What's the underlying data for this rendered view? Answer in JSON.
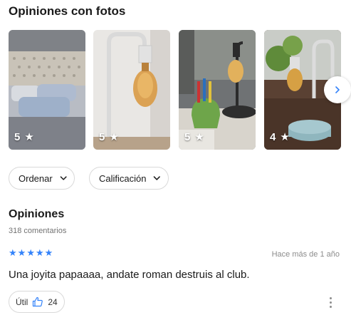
{
  "photos": {
    "title": "Opiniones con fotos",
    "items": [
      {
        "rating": "5",
        "star_icon": "star-icon"
      },
      {
        "rating": "5",
        "star_icon": "star-icon"
      },
      {
        "rating": "5",
        "star_icon": "star-icon"
      },
      {
        "rating": "4",
        "star_icon": "star-icon"
      }
    ],
    "next_icon": "chevron-right-icon"
  },
  "filters": {
    "sort_label": "Ordenar",
    "rating_label": "Calificación"
  },
  "reviews": {
    "title": "Opiniones",
    "count": "318 comentarios",
    "items": [
      {
        "stars": 5,
        "date": "Hace más de 1 año",
        "text": "Una joyita papaaaa, andate roman destruis al club.",
        "helpful_label": "Útil",
        "helpful_count": "24"
      }
    ]
  },
  "colors": {
    "accent": "#3483fa",
    "muted": "#737373",
    "border": "#d9d9d9"
  }
}
